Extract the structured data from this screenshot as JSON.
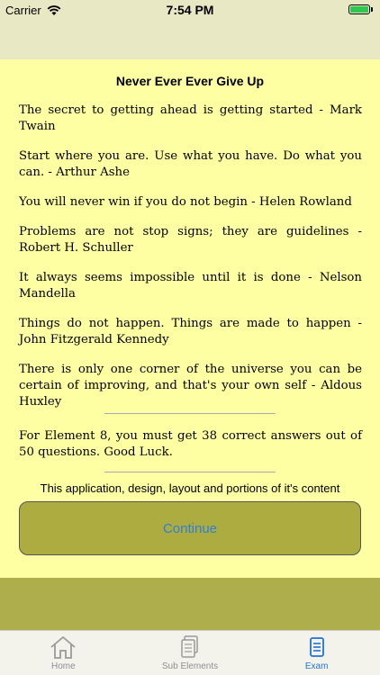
{
  "status": {
    "carrier": "Carrier",
    "time": "7:54 PM"
  },
  "title": "Never Ever Ever Give Up",
  "quotes": [
    "The secret to getting ahead is getting started - Mark Twain",
    "Start where you are. Use what you have. Do what you can. - Arthur Ashe",
    "You will never win if you do not begin - Helen Rowland",
    "Problems are not stop signs; they are guidelines - Robert H. Schuller",
    "It always seems impossible until it is done - Nelson Mandella",
    "Things do not happen. Things are made to happen - John Fitzgerald Kennedy",
    "There is only one corner of the universe you can be certain of improving, and that's your own self - Aldous Huxley"
  ],
  "element_note": "For Element 8, you must get 38 correct answers out of 50 questions. Good Luck.",
  "copyright": "This application, design, layout and portions of it's content",
  "continue_label": "Continue",
  "tabs": [
    {
      "label": "Home",
      "icon": "home-icon",
      "active": false
    },
    {
      "label": "Sub Elements",
      "icon": "documents-icon",
      "active": false
    },
    {
      "label": "Exam",
      "icon": "exam-icon",
      "active": true
    }
  ],
  "colors": {
    "background": "#fefea2",
    "button": "#adac41",
    "accent": "#1e73d8"
  }
}
